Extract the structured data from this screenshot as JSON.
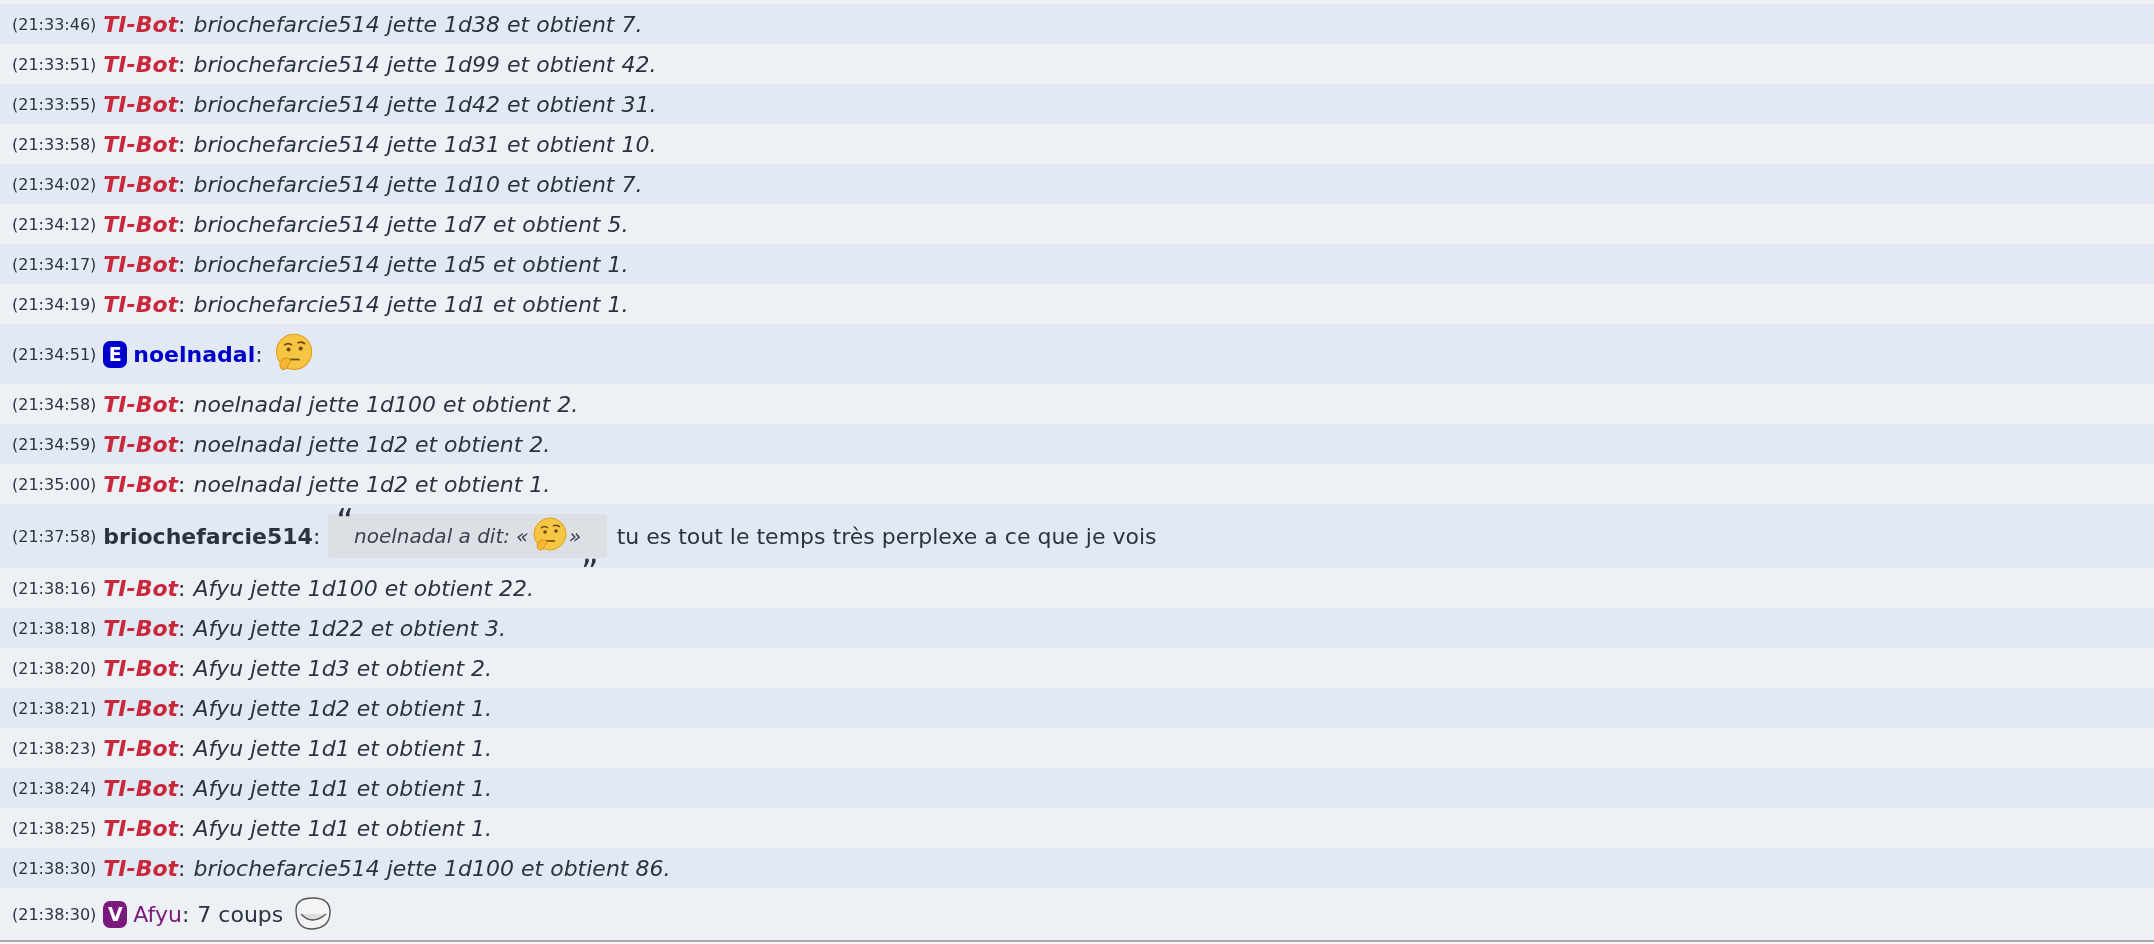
{
  "messages": [
    {
      "time": "(21:33:46)",
      "author": "TI-Bot",
      "kind": "bot",
      "color": "#c8283c",
      "bold": true,
      "colon": ":",
      "parts": [
        {
          "kind": "text",
          "text": "briochefarcie514 jette 1d38 et obtient 7."
        }
      ]
    },
    {
      "time": "(21:33:51)",
      "author": "TI-Bot",
      "kind": "bot",
      "color": "#c8283c",
      "bold": true,
      "colon": ":",
      "parts": [
        {
          "kind": "text",
          "text": "briochefarcie514 jette 1d99 et obtient 42."
        }
      ]
    },
    {
      "time": "(21:33:55)",
      "author": "TI-Bot",
      "kind": "bot",
      "color": "#c8283c",
      "bold": true,
      "colon": ":",
      "parts": [
        {
          "kind": "text",
          "text": "briochefarcie514 jette 1d42 et obtient 31."
        }
      ]
    },
    {
      "time": "(21:33:58)",
      "author": "TI-Bot",
      "kind": "bot",
      "color": "#c8283c",
      "bold": true,
      "colon": ":",
      "parts": [
        {
          "kind": "text",
          "text": "briochefarcie514 jette 1d31 et obtient 10."
        }
      ]
    },
    {
      "time": "(21:34:02)",
      "author": "TI-Bot",
      "kind": "bot",
      "color": "#c8283c",
      "bold": true,
      "colon": ":",
      "parts": [
        {
          "kind": "text",
          "text": "briochefarcie514 jette 1d10 et obtient 7."
        }
      ]
    },
    {
      "time": "(21:34:12)",
      "author": "TI-Bot",
      "kind": "bot",
      "color": "#c8283c",
      "bold": true,
      "colon": ":",
      "parts": [
        {
          "kind": "text",
          "text": "briochefarcie514 jette 1d7 et obtient 5."
        }
      ]
    },
    {
      "time": "(21:34:17)",
      "author": "TI-Bot",
      "kind": "bot",
      "color": "#c8283c",
      "bold": true,
      "colon": ":",
      "parts": [
        {
          "kind": "text",
          "text": "briochefarcie514 jette 1d5 et obtient 1."
        }
      ]
    },
    {
      "time": "(21:34:19)",
      "author": "TI-Bot",
      "kind": "bot",
      "color": "#c8283c",
      "bold": true,
      "colon": ":",
      "parts": [
        {
          "kind": "text",
          "text": "briochefarcie514 jette 1d1 et obtient 1."
        }
      ]
    },
    {
      "time": "(21:34:51)",
      "author": "noelnadal",
      "kind": "user",
      "badge": "E",
      "color": "#0000cc",
      "bold": true,
      "colon": ":",
      "parts": [
        {
          "kind": "thinking"
        }
      ]
    },
    {
      "time": "(21:34:58)",
      "author": "TI-Bot",
      "kind": "bot",
      "color": "#c8283c",
      "bold": true,
      "colon": ":",
      "parts": [
        {
          "kind": "text",
          "text": "noelnadal jette 1d100 et obtient 2."
        }
      ]
    },
    {
      "time": "(21:34:59)",
      "author": "TI-Bot",
      "kind": "bot",
      "color": "#c8283c",
      "bold": true,
      "colon": ":",
      "parts": [
        {
          "kind": "text",
          "text": "noelnadal jette 1d2 et obtient 2."
        }
      ]
    },
    {
      "time": "(21:35:00)",
      "author": "TI-Bot",
      "kind": "bot",
      "color": "#c8283c",
      "bold": true,
      "colon": ":",
      "parts": [
        {
          "kind": "text",
          "text": "noelnadal jette 1d2 et obtient 1."
        }
      ]
    },
    {
      "time": "(21:37:58)",
      "author": "briochefarcie514",
      "kind": "user",
      "color": "#2b3340",
      "bold": true,
      "colon": ":",
      "parts": [
        {
          "kind": "quote",
          "open": "“",
          "text": "noelnadal a dit: «",
          "after": "»",
          "close": "„"
        },
        {
          "kind": "text",
          "text": "tu es tout le temps très perplexe a ce que je vois"
        }
      ]
    },
    {
      "time": "(21:38:16)",
      "author": "TI-Bot",
      "kind": "bot",
      "color": "#c8283c",
      "bold": true,
      "colon": ":",
      "parts": [
        {
          "kind": "text",
          "text": "Afyu jette 1d100 et obtient 22."
        }
      ]
    },
    {
      "time": "(21:38:18)",
      "author": "TI-Bot",
      "kind": "bot",
      "color": "#c8283c",
      "bold": true,
      "colon": ":",
      "parts": [
        {
          "kind": "text",
          "text": "Afyu jette 1d22 et obtient 3."
        }
      ]
    },
    {
      "time": "(21:38:20)",
      "author": "TI-Bot",
      "kind": "bot",
      "color": "#c8283c",
      "bold": true,
      "colon": ":",
      "parts": [
        {
          "kind": "text",
          "text": "Afyu jette 1d3 et obtient 2."
        }
      ]
    },
    {
      "time": "(21:38:21)",
      "author": "TI-Bot",
      "kind": "bot",
      "color": "#c8283c",
      "bold": true,
      "colon": ":",
      "parts": [
        {
          "kind": "text",
          "text": "Afyu jette 1d2 et obtient 1."
        }
      ]
    },
    {
      "time": "(21:38:23)",
      "author": "TI-Bot",
      "kind": "bot",
      "color": "#c8283c",
      "bold": true,
      "colon": ":",
      "parts": [
        {
          "kind": "text",
          "text": "Afyu jette 1d1 et obtient 1."
        }
      ]
    },
    {
      "time": "(21:38:24)",
      "author": "TI-Bot",
      "kind": "bot",
      "color": "#c8283c",
      "bold": true,
      "colon": ":",
      "parts": [
        {
          "kind": "text",
          "text": "Afyu jette 1d1 et obtient 1."
        }
      ]
    },
    {
      "time": "(21:38:25)",
      "author": "TI-Bot",
      "kind": "bot",
      "color": "#c8283c",
      "bold": true,
      "colon": ":",
      "parts": [
        {
          "kind": "text",
          "text": "Afyu jette 1d1 et obtient 1."
        }
      ]
    },
    {
      "time": "(21:38:30)",
      "author": "TI-Bot",
      "kind": "bot",
      "color": "#c8283c",
      "bold": true,
      "colon": ":",
      "parts": [
        {
          "kind": "text",
          "text": "briochefarcie514 jette 1d100 et obtient 86."
        }
      ]
    },
    {
      "time": "(21:38:30)",
      "author": "Afyu",
      "kind": "user",
      "badge": "V",
      "color": "#7b1a7d",
      "bold": false,
      "colon": ":",
      "parts": [
        {
          "kind": "text",
          "text": "7 coups"
        },
        {
          "kind": "sticker"
        }
      ]
    }
  ]
}
